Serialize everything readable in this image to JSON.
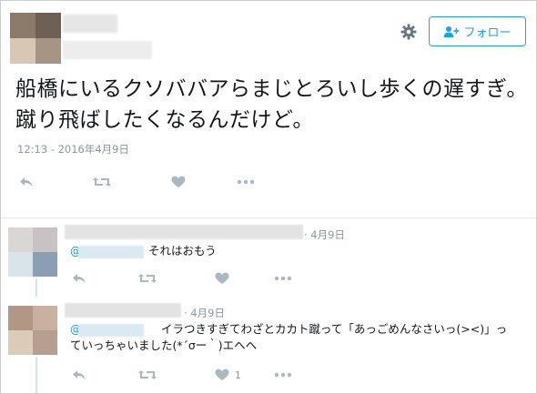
{
  "tweet": {
    "text": "船橋にいるクソババアらまじとろいし歩くの遅すぎ。蹴り飛ばしたくなるんだけど。",
    "timestamp": "12:13 - 2016年4月9日",
    "follow_label": "フォロー"
  },
  "replies": [
    {
      "date": "· 4月9日",
      "mention": "@",
      "text": "それはおもう",
      "like_count": ""
    },
    {
      "date": "· 4月9日",
      "mention": "@",
      "text": "イラつきすぎてわざとカカト蹴って「あっごめんなさいっ(>&lt;)」っていっちゃいました(*´σー｀)エヘヘ",
      "like_count": "1"
    }
  ],
  "colors": {
    "accent": "#1da1f2",
    "muted": "#8899a6",
    "thread": "#cde6f7"
  },
  "icons": [
    "gear-icon",
    "follow-user-icon",
    "reply-icon",
    "retweet-icon",
    "like-icon",
    "more-icon"
  ]
}
